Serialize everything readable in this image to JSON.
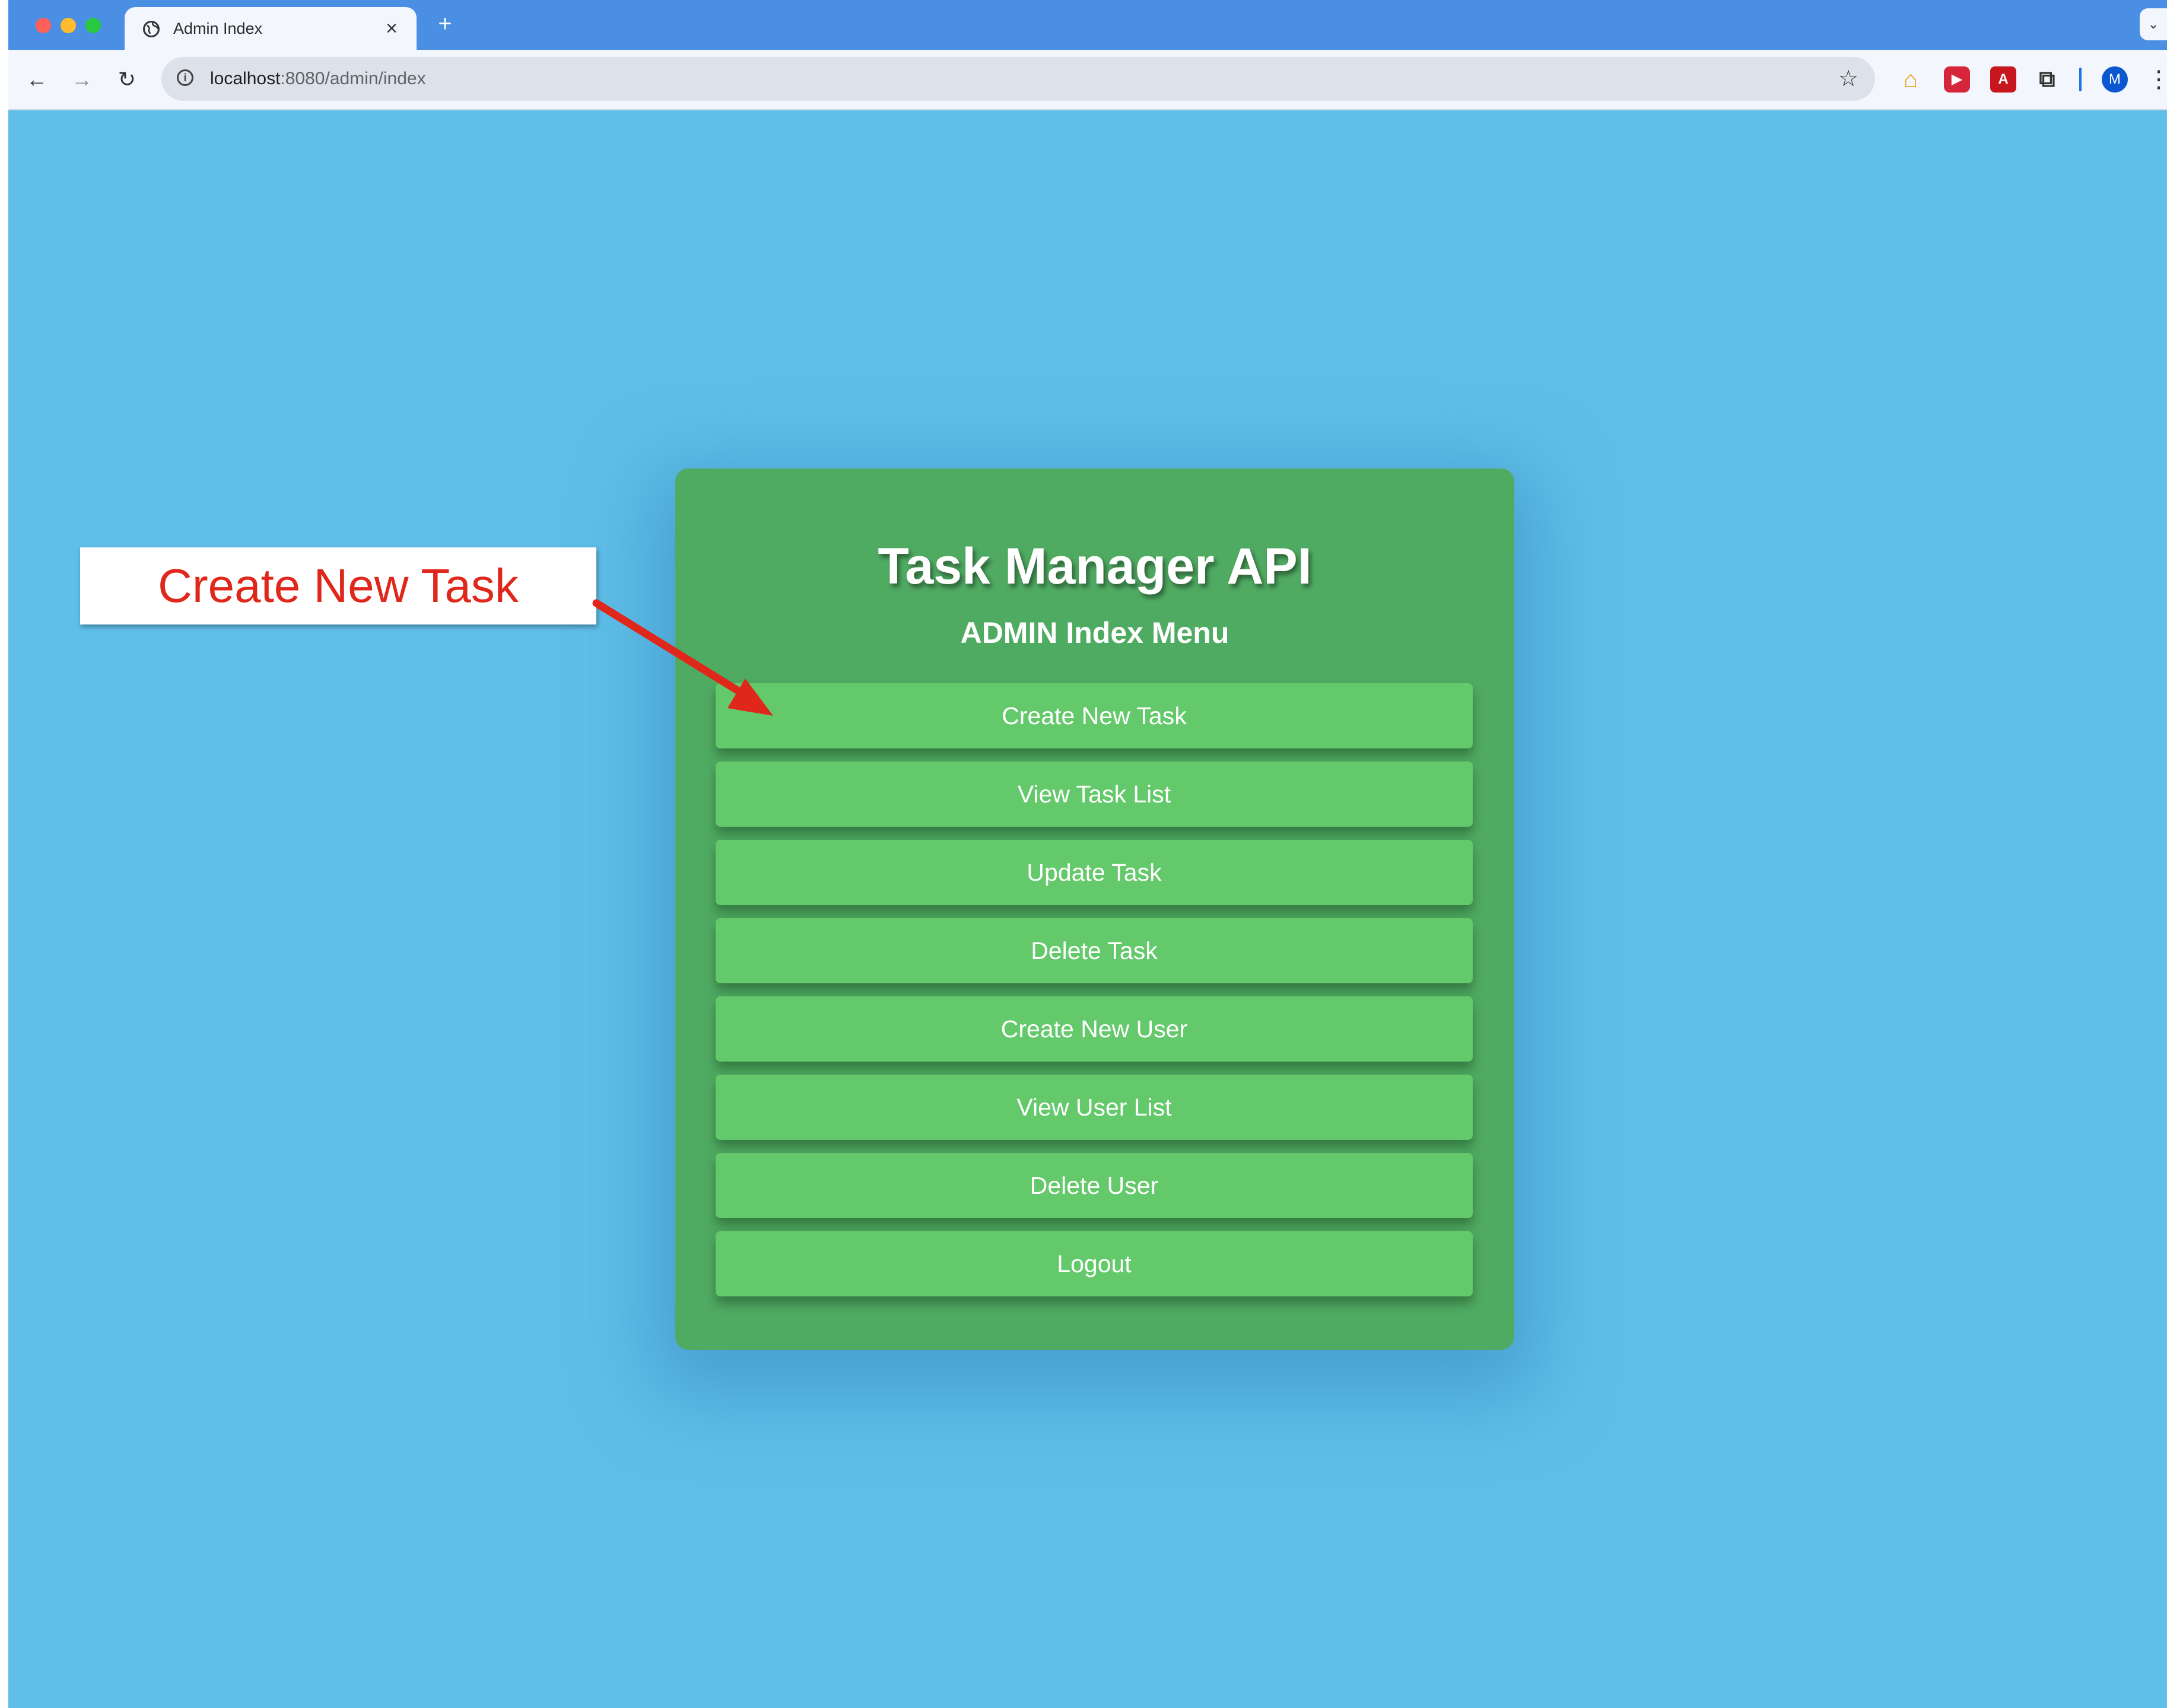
{
  "browser": {
    "tab_title": "Admin Index",
    "tab_close": "×",
    "new_tab": "+",
    "tab_menu": "⌄",
    "url_host": "localhost",
    "url_path": ":8080/admin/index",
    "avatar_letter": "M"
  },
  "page": {
    "title": "Task Manager API",
    "subtitle": "ADMIN Index Menu",
    "menu": [
      {
        "label": "Create New Task"
      },
      {
        "label": "View Task List"
      },
      {
        "label": "Update Task"
      },
      {
        "label": "Delete Task"
      },
      {
        "label": "Create New User"
      },
      {
        "label": "View User List"
      },
      {
        "label": "Delete User"
      },
      {
        "label": "Logout"
      }
    ]
  },
  "annotation": {
    "callout_text": "Create New Task"
  },
  "colors": {
    "page_bg": "#5fbfe8",
    "card": "#50ab62",
    "button": "#63c96a",
    "callout_text": "#e0271b",
    "arrow": "#e0271b"
  }
}
